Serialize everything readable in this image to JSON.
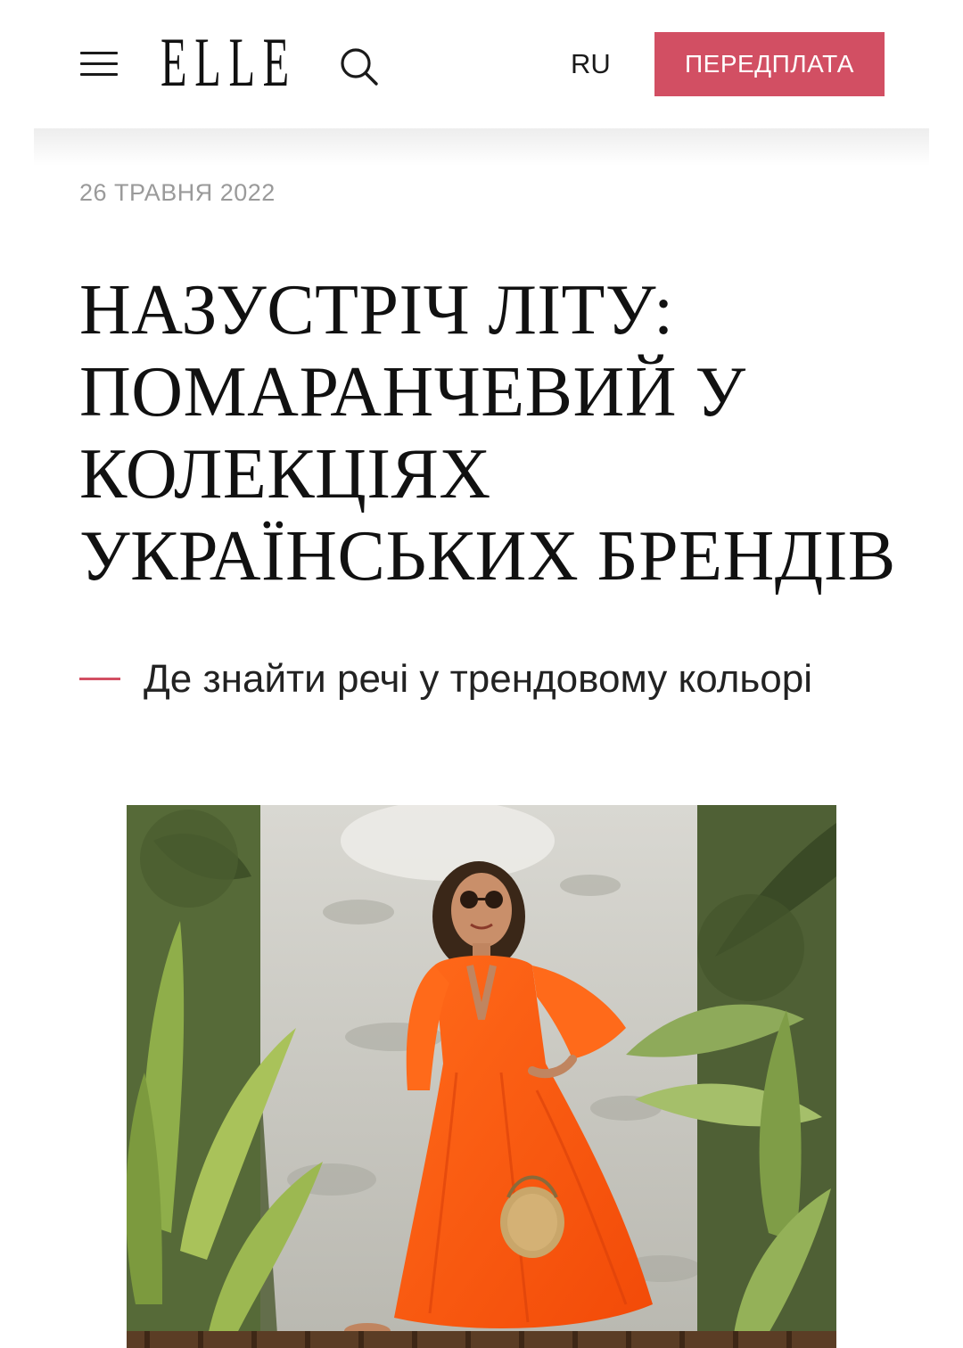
{
  "header": {
    "logo": "ELLE",
    "lang": "RU",
    "subscribe_label": "ПЕРЕДПЛАТА",
    "accent_color": "#d24f63",
    "icons": {
      "menu": "hamburger-menu-icon",
      "search": "search-icon"
    }
  },
  "article": {
    "date": "26 ТРАВНЯ 2022",
    "title_lines": [
      "НАЗУСТРІЧ ЛІТУ:",
      "ПОМАРАНЧЕВИЙ У",
      "КОЛЕКЦІЯХ",
      "УКРАЇНСЬКИХ БРЕНДІВ"
    ],
    "subtitle": "Де знайти речі у трендовому кольорі"
  }
}
